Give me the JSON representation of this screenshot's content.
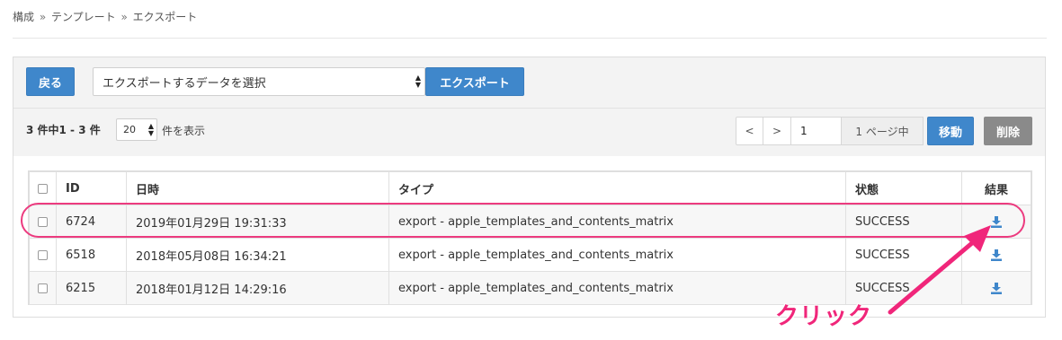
{
  "breadcrumb": [
    "構成",
    "テンプレート",
    "エクスポート"
  ],
  "breadcrumb_sep": "»",
  "toolbar": {
    "back_label": "戻る",
    "select_value": "エクスポートするデータを選択",
    "export_label": "エクスポート"
  },
  "pager": {
    "count_text": "3 件中1 - 3 件",
    "per_page": "20",
    "per_page_label": "件を表示",
    "prev": "<",
    "next": ">",
    "page_input": "1",
    "page_total": "1 ページ中",
    "move_label": "移動",
    "delete_label": "削除"
  },
  "table": {
    "headers": {
      "id": "ID",
      "datetime": "日時",
      "type": "タイプ",
      "status": "状態",
      "result": "結果"
    },
    "rows": [
      {
        "id": "6724",
        "datetime": "2019年01月29日 19:31:33",
        "type": "export - apple_templates_and_contents_matrix",
        "status": "SUCCESS"
      },
      {
        "id": "6518",
        "datetime": "2018年05月08日 16:34:21",
        "type": "export - apple_templates_and_contents_matrix",
        "status": "SUCCESS"
      },
      {
        "id": "6215",
        "datetime": "2018年01月12日 14:29:16",
        "type": "export - apple_templates_and_contents_matrix",
        "status": "SUCCESS"
      }
    ]
  },
  "annotation": {
    "label": "クリック",
    "color": "#f0267a"
  },
  "colors": {
    "primary": "#3f87cb",
    "danger_gray": "#8a8a8a",
    "highlight": "#ec3b7f"
  },
  "icons": {
    "download": "download-icon",
    "sort": "select-arrows-icon"
  }
}
